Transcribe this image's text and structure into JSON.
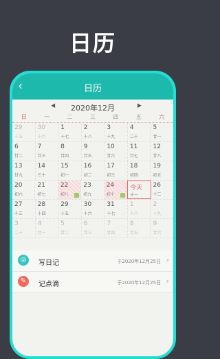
{
  "headline": "日历",
  "app": {
    "title": "日历",
    "back_icon": "‹"
  },
  "month": {
    "label": "2020年12月",
    "prev": "◀",
    "next": "▶"
  },
  "weekdays": [
    "日",
    "一",
    "二",
    "三",
    "四",
    "五",
    "六"
  ],
  "weeks": [
    [
      {
        "d": "29",
        "l": "十五",
        "muted": true
      },
      {
        "d": "30",
        "l": "十六",
        "muted": true
      },
      {
        "d": "1",
        "l": "十七"
      },
      {
        "d": "2",
        "l": "十八"
      },
      {
        "d": "3",
        "l": "十九"
      },
      {
        "d": "4",
        "l": "二十"
      },
      {
        "d": "5",
        "l": "廿一"
      }
    ],
    [
      {
        "d": "6",
        "l": "廿二"
      },
      {
        "d": "7",
        "l": "廿三"
      },
      {
        "d": "8",
        "l": "廿四"
      },
      {
        "d": "9",
        "l": "廿五"
      },
      {
        "d": "10",
        "l": "廿六"
      },
      {
        "d": "11",
        "l": "廿七"
      },
      {
        "d": "12",
        "l": "廿八"
      }
    ],
    [
      {
        "d": "13",
        "l": "廿九"
      },
      {
        "d": "14",
        "l": "三十"
      },
      {
        "d": "15",
        "l": "初一"
      },
      {
        "d": "16",
        "l": "初二"
      },
      {
        "d": "17",
        "l": "初三"
      },
      {
        "d": "18",
        "l": "初四"
      },
      {
        "d": "19",
        "l": "初五"
      }
    ],
    [
      {
        "d": "20",
        "l": "初六"
      },
      {
        "d": "21",
        "l": "初七"
      },
      {
        "d": "22",
        "l": "初八",
        "hl": true,
        "mark": true
      },
      {
        "d": "23",
        "l": "初九"
      },
      {
        "d": "24",
        "l": "初十",
        "hl": true,
        "mark": true
      },
      {
        "d": "今天",
        "l": "十一",
        "today": true
      },
      {
        "d": "26",
        "l": "十二"
      }
    ],
    [
      {
        "d": "27",
        "l": "十三"
      },
      {
        "d": "28",
        "l": "十四"
      },
      {
        "d": "29",
        "l": "十五"
      },
      {
        "d": "30",
        "l": "十六"
      },
      {
        "d": "31",
        "l": "十七"
      },
      {
        "d": "1",
        "l": "十八",
        "muted": true
      },
      {
        "d": "2",
        "l": "十九",
        "muted": true
      }
    ],
    [
      {
        "d": "3",
        "l": "二十",
        "muted": true
      },
      {
        "d": "4",
        "l": "廿一",
        "muted": true
      },
      {
        "d": "5",
        "l": "廿二",
        "muted": true
      },
      {
        "d": "6",
        "l": "廿三",
        "muted": true
      },
      {
        "d": "7",
        "l": "廿四",
        "muted": true
      },
      {
        "d": "8",
        "l": "廿五",
        "muted": true
      },
      {
        "d": "9",
        "l": "廿六",
        "muted": true
      }
    ]
  ],
  "items": [
    {
      "name": "写日记",
      "date": "于2020年12月25日",
      "icon": "camera-icon",
      "color": "#35c4c0",
      "glyph": "◎"
    },
    {
      "name": "记点滴",
      "date": "于2020年12月25日",
      "icon": "pen-icon",
      "color": "#f06a5f",
      "glyph": "✎"
    }
  ],
  "colors": {
    "background": "#3a3d46",
    "accent": "#1eb9ad",
    "frame": "#22ded2",
    "weekend": "#e06860"
  }
}
